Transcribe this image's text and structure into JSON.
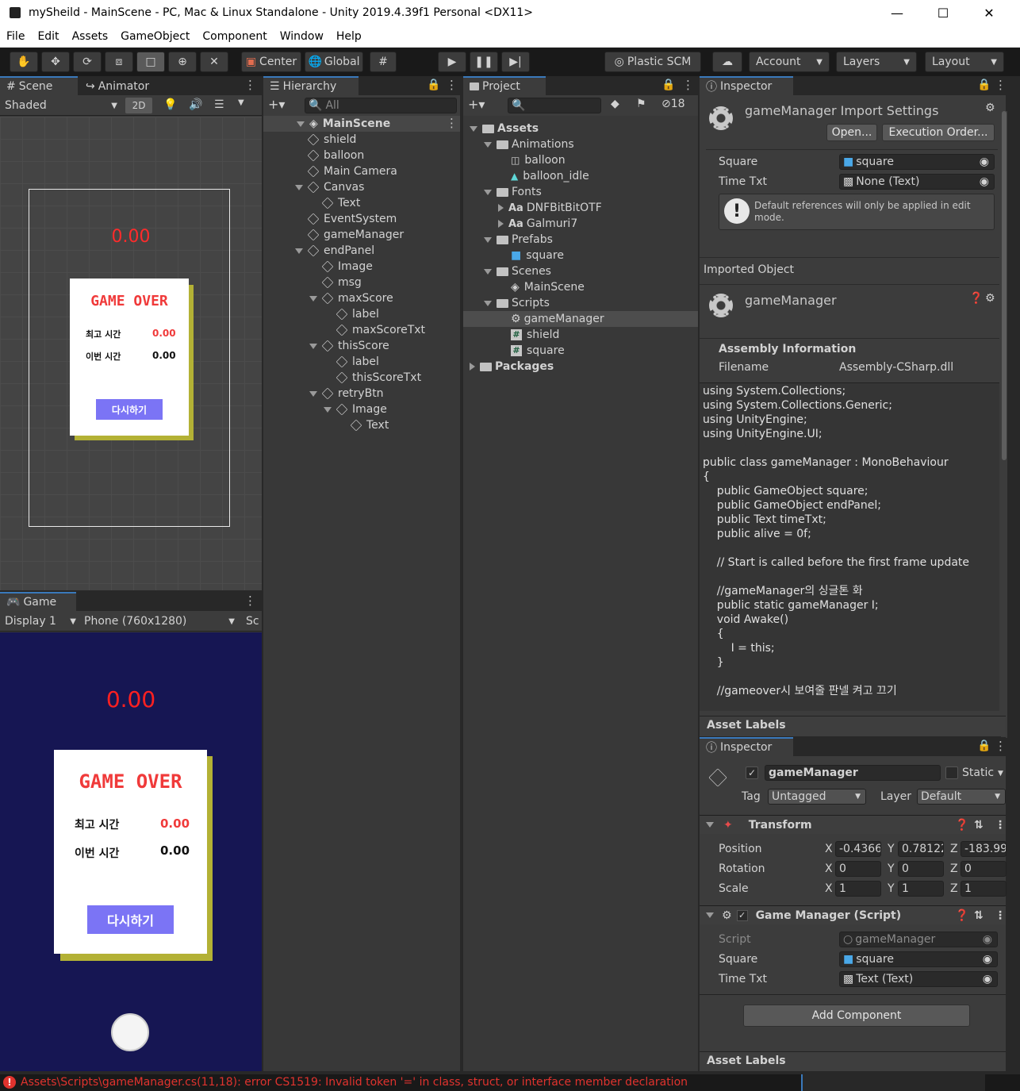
{
  "window": {
    "title": "mySheild - MainScene - PC, Mac & Linux Standalone - Unity 2019.4.39f1 Personal <DX11>"
  },
  "menu": [
    "File",
    "Edit",
    "Assets",
    "GameObject",
    "Component",
    "Window",
    "Help"
  ],
  "toolbar": {
    "center": "Center",
    "global": "Global",
    "plastic": "Plastic SCM",
    "account": "Account",
    "layers": "Layers",
    "layout": "Layout"
  },
  "scene": {
    "tab_scene": "Scene",
    "tab_animator": "Animator",
    "shaded": "Shaded",
    "mode2d": "2D",
    "score": "0.00",
    "game_over": "GAME OVER",
    "best_label": "최고 시간",
    "best_value": "0.00",
    "this_label": "이번 시간",
    "this_value": "0.00",
    "retry": "다시하기"
  },
  "game": {
    "tab": "Game",
    "display": "Display 1",
    "phone": "Phone (760x1280)",
    "sc": "Sc",
    "score": "0.00",
    "game_over": "GAME OVER",
    "best_label": "최고 시간",
    "best_value": "0.00",
    "this_label": "이번 시간",
    "this_value": "0.00",
    "retry": "다시하기"
  },
  "hierarchy": {
    "tab": "Hierarchy",
    "search": "All",
    "root": "MainScene",
    "items": [
      "shield",
      "balloon",
      "Main Camera",
      "Canvas",
      "Text",
      "EventSystem",
      "gameManager",
      "endPanel",
      "Image",
      "msg",
      "maxScore",
      "label",
      "maxScoreTxt",
      "thisScore",
      "label",
      "thisScoreTxt",
      "retryBtn",
      "Image",
      "Text"
    ]
  },
  "project": {
    "tab": "Project",
    "hidden_count": "18",
    "items": [
      "Assets",
      "Animations",
      "balloon",
      "balloon_idle",
      "Fonts",
      "DNFBitBitOTF",
      "Galmuri7",
      "Prefabs",
      "square",
      "Scenes",
      "MainScene",
      "Scripts",
      "gameManager",
      "shield",
      "square",
      "Packages"
    ],
    "font_prefix": "Aa"
  },
  "inspector_top": {
    "tab": "Inspector",
    "title": "gameManager Import Settings",
    "open": "Open...",
    "exec_order": "Execution Order...",
    "square_label": "Square",
    "square_value": "square",
    "time_label": "Time Txt",
    "time_value": "None (Text)",
    "warning": "Default references will only be applied in edit mode.",
    "imported": "Imported Object",
    "obj_name": "gameManager",
    "assembly": "Assembly Information",
    "filename_label": "Filename",
    "filename_value": "Assembly-CSharp.dll",
    "code": "using System.Collections;\nusing System.Collections.Generic;\nusing UnityEngine;\nusing UnityEngine.UI;\n\npublic class gameManager : MonoBehaviour\n{\n    public GameObject square;\n    public GameObject endPanel;\n    public Text timeTxt;\n    public alive = 0f;\n\n    // Start is called before the first frame update\n\n    //gameManager의 싱글톤 화\n    public static gameManager I;\n    void Awake()\n    {\n        I = this;\n    }\n\n    //gameover시 보여줄 판넬 켜고 끄기",
    "asset_labels": "Asset Labels"
  },
  "inspector_bottom": {
    "tab": "Inspector",
    "name": "gameManager",
    "static": "Static",
    "tag_label": "Tag",
    "tag": "Untagged",
    "layer_label": "Layer",
    "layer": "Default",
    "transform": "Transform",
    "position": "Position",
    "rotation": "Rotation",
    "scale": "Scale",
    "px": "-0.4366",
    "py": "0.78122",
    "pz": "-183.99",
    "rx": "0",
    "ry": "0",
    "rz": "0",
    "sx": "1",
    "sy": "1",
    "sz": "1",
    "axis_x": "X",
    "axis_y": "Y",
    "axis_z": "Z",
    "script_comp": "Game Manager (Script)",
    "script_label": "Script",
    "script_value": "gameManager",
    "square_label": "Square",
    "square_value": "square",
    "time_label": "Time Txt",
    "time_value": "Text (Text)",
    "add_component": "Add Component",
    "asset_labels": "Asset Labels"
  },
  "status": {
    "error": "Assets\\Scripts\\gameManager.cs(11,18): error CS1519: Invalid token '=' in class, struct, or interface member declaration"
  },
  "colors": {
    "error_red": "#e0332e",
    "game_bg": "#161653",
    "game_over_red": "#f03a3a",
    "button_purple": "#7b74f5",
    "panel_shadow": "#b3b135"
  }
}
